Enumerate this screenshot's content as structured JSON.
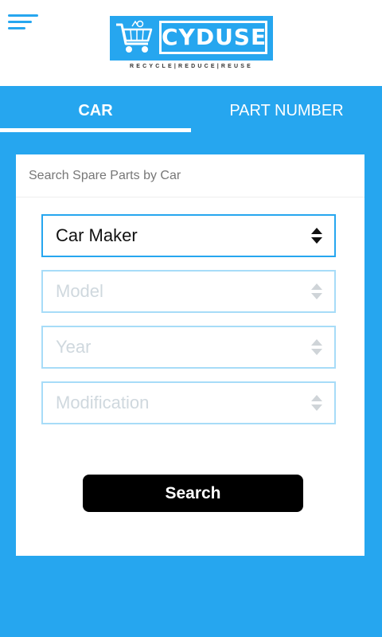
{
  "header": {
    "brand": "CYDUSE",
    "tagline": "RECYCLE|REDUCE|REUSE",
    "menu_icon": "hamburger-menu-icon",
    "logo_icon": "shopping-cart-recycle-icon"
  },
  "tabs": [
    {
      "label": "CAR",
      "active": true
    },
    {
      "label": "PART NUMBER",
      "active": false
    }
  ],
  "search_card": {
    "title": "Search Spare Parts by Car",
    "selects": [
      {
        "value": "Car Maker",
        "enabled": true
      },
      {
        "value": "Model",
        "enabled": false
      },
      {
        "value": "Year",
        "enabled": false
      },
      {
        "value": "Modification",
        "enabled": false
      }
    ],
    "search_label": "Search"
  },
  "colors": {
    "accent": "#26a6ef",
    "accent_light": "#a7dcf8",
    "button": "#000000"
  }
}
